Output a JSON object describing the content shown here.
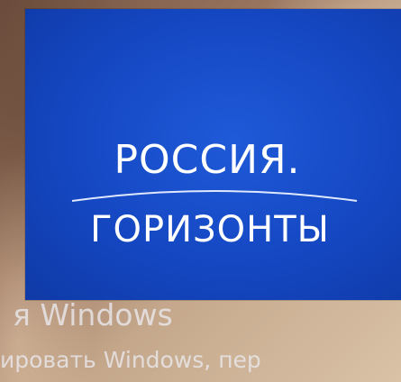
{
  "poster": {
    "title_line1": "РОССИЯ.",
    "title_line2": "ГОРИЗОНТЫ",
    "background_color": "#1547c2"
  },
  "watermark": {
    "line1": "я Windows",
    "line2": "ировать Windows, пер"
  }
}
